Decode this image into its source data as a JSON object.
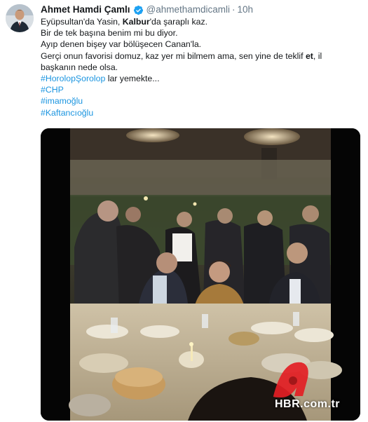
{
  "author": {
    "name": "Ahmet Hamdi Çamlı",
    "handle": "@ahmethamdicamli",
    "separator": "·",
    "time": "10h",
    "verified": true
  },
  "tweet": {
    "line1_pre": "Eyüpsultan'da Yasin, ",
    "line1_bold": "Kalbur",
    "line1_post": "'da şaraplı kaz.",
    "line2": "Bir de tek başına benim mi bu diyor.",
    "line3": "Ayıp denen bişey var bölüşecen Canan'la.",
    "line4_pre": "Gerçi onun favorisi domuz, kaz yer mi bilmem ama, sen yine de teklif ",
    "line4_bold": "et",
    "line4_post": ", il",
    "line5": "başkanın nede olsa.",
    "hashtag1": "#HorolopŞorolop",
    "hashtag1_suffix": " lar yemekte...",
    "hashtags": [
      "#CHP",
      "#imamoğlu",
      "#Kaftancıoğlu"
    ]
  },
  "media": {
    "type": "video",
    "watermark": "HBR.com.tr",
    "watermark_letter": "a"
  },
  "colors": {
    "link": "#1b95e0",
    "verified": "#1da1f2",
    "secondary": "#657786",
    "watermark_red": "#e31e24"
  }
}
